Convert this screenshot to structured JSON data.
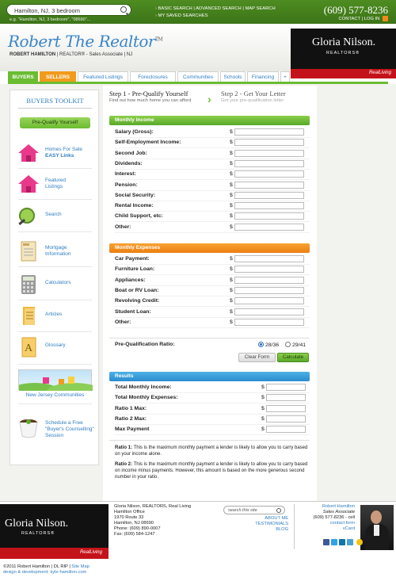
{
  "topbar": {
    "search_value": "Hamilton, NJ, 3 bedroom",
    "search_hint": "e.g. \"Hamilton, NJ, 3 bedroom\", \"08690\"...",
    "links": [
      "BASIC SEARCH",
      "ADVANCED SEARCH",
      "MAP SEARCH"
    ],
    "saved_searches": "MY SAVED SEARCHES",
    "phone": "(609) 577-8236",
    "contact": "CONTACT",
    "login": "LOG IN"
  },
  "header": {
    "title": "Robert The Realtor",
    "tm": "TM",
    "agent_name": "ROBERT HAMILTON",
    "agent_role": "REALTOR® - Sales Associate",
    "agent_state": "NJ",
    "brand_name": "Gloria Nilson.",
    "brand_sub": "REALTORS®",
    "brand_tag": "RealLiving"
  },
  "nav": {
    "tabs": [
      "BUYERS",
      "SELLERS",
      "Featured Listings",
      "Foreclosures",
      "Communities",
      "Schools",
      "Financing",
      "+"
    ]
  },
  "sidebar": {
    "title": "BUYERS TOOLKIT",
    "prequal_button": "Pre-Qualify Yourself",
    "items": [
      {
        "label": "Homes For Sale",
        "label2": "EASY Links",
        "icon": "house-icon"
      },
      {
        "label": "Featured",
        "label2": "Listings",
        "icon": "house-icon"
      },
      {
        "label": "Search",
        "label2": "",
        "icon": "magnifier-icon"
      },
      {
        "label": "Mortgage",
        "label2": "Information",
        "icon": "loan-document-icon"
      },
      {
        "label": "Calculators",
        "label2": "",
        "icon": "calculator-icon"
      },
      {
        "label": "Articles",
        "label2": "",
        "icon": "article-icon"
      },
      {
        "label": "Glossary",
        "label2": "",
        "icon": "glossary-icon"
      }
    ],
    "communities": "New Jersey Communities",
    "counselling_line1": "Schedule a Free",
    "counselling_line2": "\"Buyer's Counselling\"",
    "counselling_line3": "Session"
  },
  "steps": {
    "step1_title": "Step 1 - Pre-Qualify Yourself",
    "step1_sub": "Find out how much home you can afford",
    "step2_title": "Step 2 - Get Your Letter",
    "step2_sub": "Get your pre-qualification letter"
  },
  "income": {
    "heading": "Monthly Income",
    "currency": "$",
    "fields": [
      "Salary (Gross):",
      "Self-Employment Income:",
      "Second Job:",
      "Dividends:",
      "Interest:",
      "Pension:",
      "Social Security:",
      "Rental Income:",
      "Child Support, etc:",
      "Other:"
    ]
  },
  "expenses": {
    "heading": "Monthly Expenses",
    "currency": "$",
    "fields": [
      "Car Payment:",
      "Furniture Loan:",
      "Appliances:",
      "Boat or RV Loan:",
      "Revolving Credit:",
      "Student Loan:",
      "Other:"
    ]
  },
  "ratio": {
    "label": "Pre-Qualification Ratio:",
    "option1": "28/36",
    "option2": "29/41",
    "selected": "28/36",
    "clear_button": "Clear Form",
    "calc_button": "Calculate"
  },
  "results": {
    "heading": "Results",
    "currency": "$",
    "fields": [
      "Total Monthly Income:",
      "Total Monthly Expenses:",
      "Ratio 1 Max:",
      "Ratio 2 Max:",
      "Max Payment"
    ]
  },
  "notes": {
    "note1_bold": "Ratio 1:",
    "note1": " This is the maximum monthly payment a lender is likely to allow you to carry based on your income alone.",
    "note2_bold": "Ratio 2:",
    "note2": " This is the maximum monthly payment a lender is likely to allow you to carry based on income minus payments. However, this amount is based on the more generous second number in your ratio."
  },
  "footer": {
    "address": [
      "Gloria Nilson, REALTORS, Real Living",
      "Hamilton Office",
      "1970 Route 33",
      "Hamilton, NJ 08690",
      "Phone: (609) 890-0007",
      "Fax: (609) 584-1247"
    ],
    "search_placeholder": "search this site",
    "links": [
      "ABOUT ME",
      "TESTIMONIALS",
      "BLOG"
    ],
    "contact_name": "Robert Hamilton",
    "contact_role": "Sales Associate",
    "contact_phone": "(609) 577-8236 - cell",
    "contact_form": "contact form",
    "vcard": "vCard",
    "copyright": "©2011 Robert Hamilton",
    "dl": "DL RIP",
    "sitemap": "Site Map",
    "credit": "design & development: kyle-hamilton.com"
  },
  "colors": {
    "green": "#6bbc32",
    "orange": "#f29a1c",
    "blue": "#2f7ec2",
    "red": "#c4121a"
  }
}
